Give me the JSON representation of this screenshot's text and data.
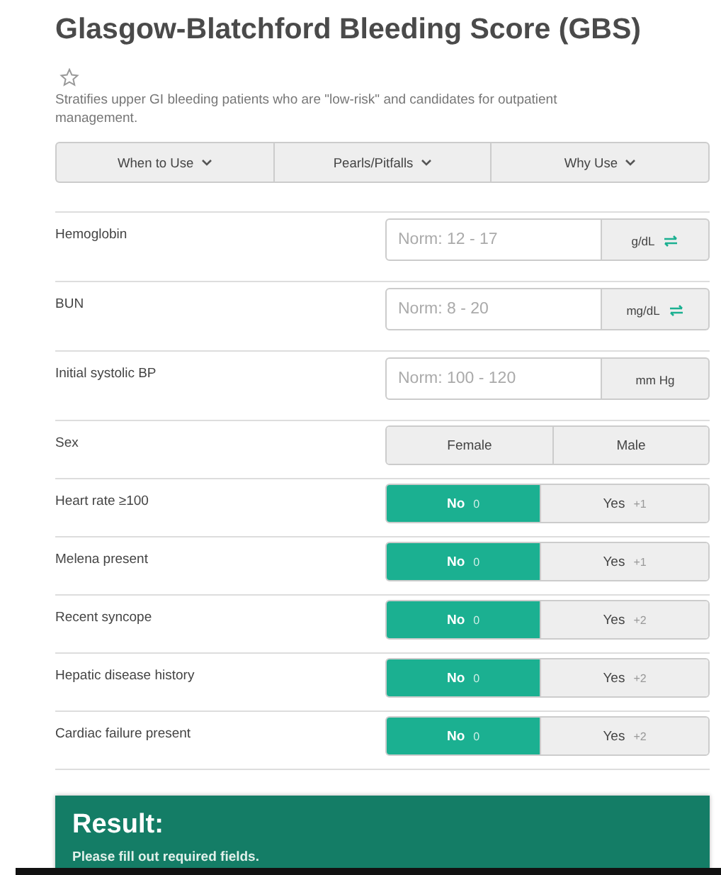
{
  "title": "Glasgow-Blatchford Bleeding Score (GBS)",
  "description": "Stratifies upper GI bleeding patients who are \"low-risk\" and candidates for outpatient management.",
  "info_tabs": [
    {
      "label": "When to Use"
    },
    {
      "label": "Pearls/Pitfalls"
    },
    {
      "label": "Why Use"
    }
  ],
  "fields": [
    {
      "kind": "number",
      "label": "Hemoglobin",
      "placeholder": "Norm: 12 - 17",
      "unit": "g/dL",
      "convertible": true
    },
    {
      "kind": "number",
      "label": "BUN",
      "placeholder": "Norm: 8 - 20",
      "unit": "mg/dL",
      "convertible": true
    },
    {
      "kind": "number",
      "label": "Initial systolic BP",
      "placeholder": "Norm: 100 - 120",
      "unit": "mm Hg",
      "convertible": false
    },
    {
      "kind": "choice",
      "label": "Sex",
      "options": [
        {
          "label": "Female",
          "selected": false
        },
        {
          "label": "Male",
          "selected": false
        }
      ]
    },
    {
      "kind": "choice",
      "label": "Heart rate ≥100",
      "options": [
        {
          "label": "No",
          "points": "0",
          "selected": true
        },
        {
          "label": "Yes",
          "points": "+1",
          "selected": false
        }
      ]
    },
    {
      "kind": "choice",
      "label": "Melena present",
      "options": [
        {
          "label": "No",
          "points": "0",
          "selected": true
        },
        {
          "label": "Yes",
          "points": "+1",
          "selected": false
        }
      ]
    },
    {
      "kind": "choice",
      "label": "Recent syncope",
      "options": [
        {
          "label": "No",
          "points": "0",
          "selected": true
        },
        {
          "label": "Yes",
          "points": "+2",
          "selected": false
        }
      ]
    },
    {
      "kind": "choice",
      "label": "Hepatic disease history",
      "options": [
        {
          "label": "No",
          "points": "0",
          "selected": true
        },
        {
          "label": "Yes",
          "points": "+2",
          "selected": false
        }
      ]
    },
    {
      "kind": "choice",
      "label": "Cardiac failure present",
      "options": [
        {
          "label": "No",
          "points": "0",
          "selected": true
        },
        {
          "label": "Yes",
          "points": "+2",
          "selected": false
        }
      ]
    }
  ],
  "result": {
    "title": "Result:",
    "message": "Please fill out required fields."
  }
}
